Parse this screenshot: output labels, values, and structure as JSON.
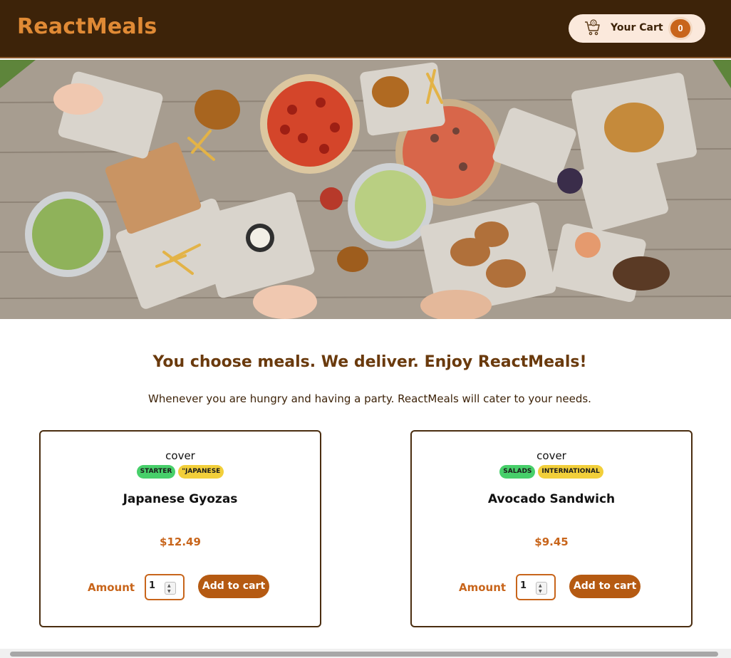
{
  "header": {
    "logo": "ReactMeals",
    "cart": {
      "label": "Your Cart",
      "count": "0",
      "icon": "cart-icon"
    }
  },
  "hero": {
    "image": "table-of-food-photo"
  },
  "intro": {
    "title": "You choose meals. We deliver. Enjoy ReactMeals!",
    "subtitle": "Whenever you are hungry and having a party. ReactMeals will cater to your needs."
  },
  "meals": [
    {
      "cover": "cover",
      "tags": [
        "STARTER",
        "\"JAPANESE"
      ],
      "name": "Japanese Gyozas",
      "price": "$12.49",
      "amount_label": "Amount",
      "amount_value": "1",
      "add_label": "Add to cart"
    },
    {
      "cover": "cover",
      "tags": [
        "SALADS",
        "INTERNATIONAL"
      ],
      "name": "Avocado Sandwich",
      "price": "$9.45",
      "amount_label": "Amount",
      "amount_value": "1",
      "add_label": "Add to cart"
    }
  ],
  "colors": {
    "header_bg": "#3d2309",
    "accent": "#c8651b",
    "title": "#6a3a0d",
    "tag_green": "#47cf6a",
    "tag_yellow": "#f2cf3a"
  }
}
